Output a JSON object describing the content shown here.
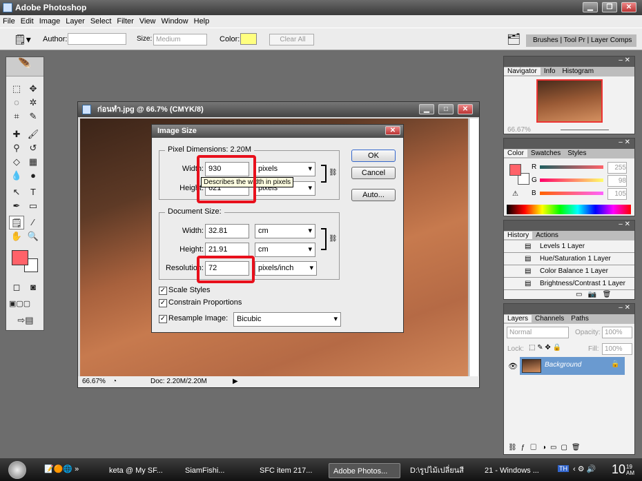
{
  "app": {
    "title": "Adobe Photoshop"
  },
  "menu": [
    "File",
    "Edit",
    "Image",
    "Layer",
    "Select",
    "Filter",
    "View",
    "Window",
    "Help"
  ],
  "options": {
    "author_label": "Author:",
    "author_value": "",
    "size_label": "Size:",
    "size_value": "Medium",
    "color_label": "Color:",
    "color_value": "#ffff80",
    "clear_label": "Clear All",
    "well_tabs": [
      "Brushes",
      "Tool Pr",
      "Layer Comps"
    ]
  },
  "document": {
    "title": "ก่อนทำ.jpg @ 66.7% (CMYK/8)",
    "zoom": "66.67%",
    "doc_info": "Doc: 2.20M/2.20M"
  },
  "dialog": {
    "title": "Image Size",
    "pixel_dims_label": "Pixel Dimensions:  2.20M",
    "width_label": "Width:",
    "width_value": "930",
    "width_unit": "pixels",
    "height_label": "Height:",
    "height_value": "621",
    "height_unit": "pixels",
    "tooltip": "Describes the width in pixels",
    "doc_size_label": "Document Size:",
    "doc_width_label": "Width:",
    "doc_width_value": "32.81",
    "doc_width_unit": "cm",
    "doc_height_label": "Height:",
    "doc_height_value": "21.91",
    "doc_height_unit": "cm",
    "resolution_label": "Resolution:",
    "resolution_value": "72",
    "resolution_unit": "pixels/inch",
    "ok": "OK",
    "cancel": "Cancel",
    "auto": "Auto...",
    "scale_styles": "Scale Styles",
    "constrain": "Constrain Proportions",
    "resample": "Resample Image:",
    "resample_value": "Bicubic",
    "scale_styles_checked": true,
    "constrain_checked": true,
    "resample_checked": true
  },
  "navigator": {
    "tabs": [
      "Navigator",
      "Info",
      "Histogram"
    ],
    "zoom": "66.67%"
  },
  "color_panel": {
    "tabs": [
      "Color",
      "Swatches",
      "Styles"
    ],
    "r_label": "R",
    "g_label": "G",
    "b_label": "B",
    "r": "255",
    "g": "98",
    "b": "105",
    "foreground": "#ff6269"
  },
  "history": {
    "tabs": [
      "History",
      "Actions"
    ],
    "items": [
      "Levels 1 Layer",
      "Hue/Saturation 1 Layer",
      "Color Balance 1 Layer",
      "Brightness/Contrast 1 Layer"
    ]
  },
  "layers": {
    "tabs": [
      "Layers",
      "Channels",
      "Paths"
    ],
    "blend": "Normal",
    "opacity_label": "Opacity:",
    "opacity": "100%",
    "lock_label": "Lock:",
    "fill_label": "Fill:",
    "fill": "100%",
    "layer_name": "Background"
  },
  "taskbar": {
    "items": [
      "keta @ My SF...",
      "SiamFishi...",
      "SFC item 217...",
      "Adobe Photos...",
      "D:\\รูปไม้เปลี่ยนสี",
      "21 - Windows ..."
    ],
    "lang": "TH",
    "clock": "10",
    "clock_ampm": "19 AM"
  }
}
